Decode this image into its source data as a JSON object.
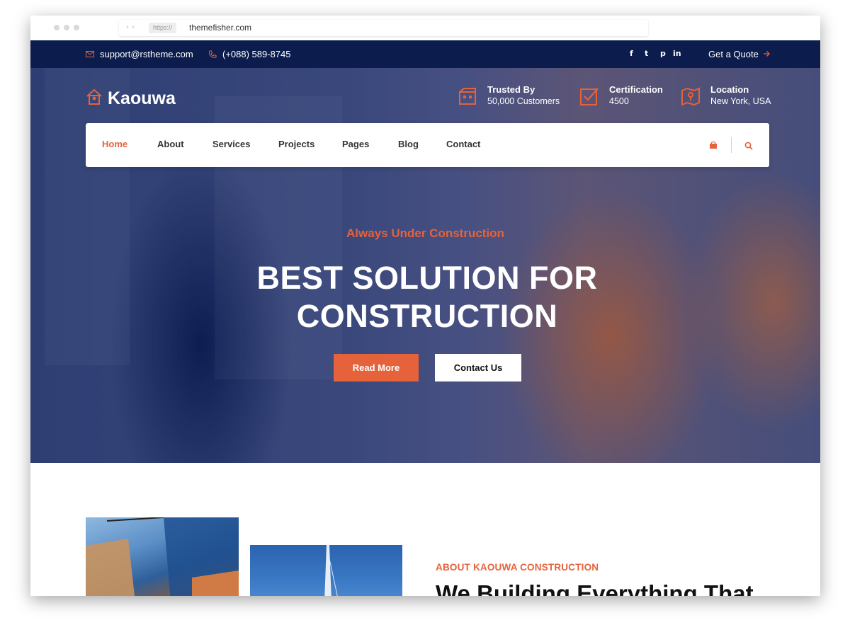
{
  "browser": {
    "protocol": "https://",
    "url": "themefisher.com"
  },
  "topbar": {
    "email": "support@rstheme.com",
    "phone": "(+088) 589-8745",
    "social": [
      "facebook-icon",
      "twitter-icon",
      "pinterest-icon",
      "linkedin-icon"
    ],
    "social_glyphs": [
      "f",
      "t",
      "p",
      "in"
    ],
    "cta": "Get a Quote"
  },
  "brand": {
    "name": "Kaouwa",
    "accent": "#e5623a",
    "navy": "#0c1d4d"
  },
  "features": [
    {
      "title": "Trusted By",
      "value": "50,000 Customers",
      "icon": "building-icon"
    },
    {
      "title": "Certification",
      "value": "4500",
      "icon": "checkbox-icon"
    },
    {
      "title": "Location",
      "value": "New York, USA",
      "icon": "map-icon"
    }
  ],
  "nav": {
    "items": [
      "Home",
      "About",
      "Services",
      "Projects",
      "Pages",
      "Blog",
      "Contact"
    ],
    "active": "Home"
  },
  "hero": {
    "tagline": "Always Under Construction",
    "headline_line1": "BEST SOLUTION FOR",
    "headline_line2": "CONSTRUCTION",
    "primary_button": "Read More",
    "secondary_button": "Contact Us"
  },
  "about": {
    "label": "ABOUT KAOUWA CONSTRUCTION",
    "title": "We Building Everything That"
  }
}
